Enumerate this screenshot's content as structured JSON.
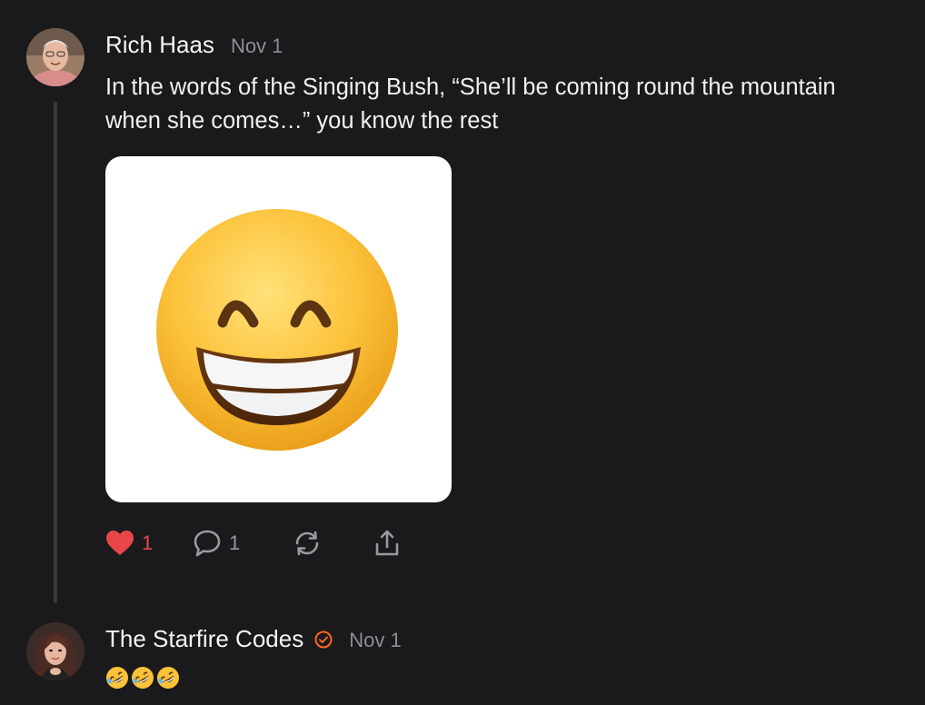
{
  "posts": [
    {
      "author": "Rich Haas",
      "date": "Nov 1",
      "text_line1": "In the words of the Singing Bush, “She’ll be coming round the mountain",
      "text_line2": "when she comes…” you know the rest",
      "image": "grinning-face-emoji",
      "likes": "1",
      "comments": "1",
      "liked": true
    },
    {
      "author": "The Starfire Codes",
      "date": "Nov 1",
      "verified": true,
      "reaction_emojis": [
        "rolling-on-floor-laughing-emoji",
        "rolling-on-floor-laughing-emoji",
        "rolling-on-floor-laughing-emoji"
      ]
    }
  ],
  "icons": {
    "like": "heart-icon",
    "comment": "comment-bubble-icon",
    "restack": "restack-icon",
    "share": "share-icon",
    "verified": "verified-badge-icon"
  },
  "colors": {
    "background": "#1a1a1c",
    "like_red": "#e8474a",
    "muted": "#8e8e93",
    "verified_orange": "#ff6719"
  }
}
